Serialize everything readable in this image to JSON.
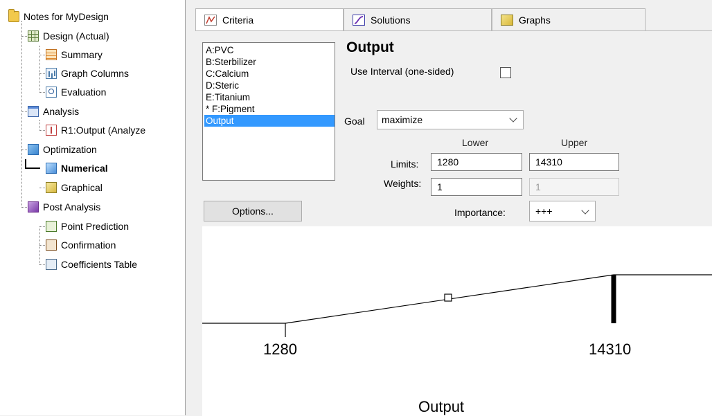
{
  "tree": {
    "root": "Notes for MyDesign",
    "design": "Design (Actual)",
    "summary": "Summary",
    "graph_columns": "Graph Columns",
    "evaluation": "Evaluation",
    "analysis": "Analysis",
    "r1": "R1:Output (Analyze",
    "optimization": "Optimization",
    "numerical": "Numerical",
    "graphical": "Graphical",
    "post_analysis": "Post Analysis",
    "point_prediction": "Point Prediction",
    "confirmation": "Confirmation",
    "coefficients_table": "Coefficients Table"
  },
  "tabs": {
    "criteria": "Criteria",
    "solutions": "Solutions",
    "graphs": "Graphs"
  },
  "responses": [
    "A:PVC",
    "B:Sterbilizer",
    "C:Calcium",
    "D:Steric",
    "E:Titanium",
    "* F:Pigment",
    "Output"
  ],
  "selected_response": "Output",
  "criteria": {
    "title": "Output",
    "interval_label": "Use Interval (one-sided)",
    "interval_checked": false,
    "goal_label": "Goal",
    "goal_value": "maximize",
    "lower_header": "Lower",
    "upper_header": "Upper",
    "limits_label": "Limits:",
    "limits_lower": "1280",
    "limits_upper": "14310",
    "weights_label": "Weights:",
    "weights_lower": "1",
    "weights_upper": "1",
    "options_label": "Options...",
    "importance_label": "Importance:",
    "importance_value": "+++"
  },
  "graph": {
    "lower_label": "1280",
    "upper_label": "14310",
    "axis_title": "Output"
  },
  "colors": {
    "selection": "#3399ff",
    "panel": "#f0f0f0"
  }
}
